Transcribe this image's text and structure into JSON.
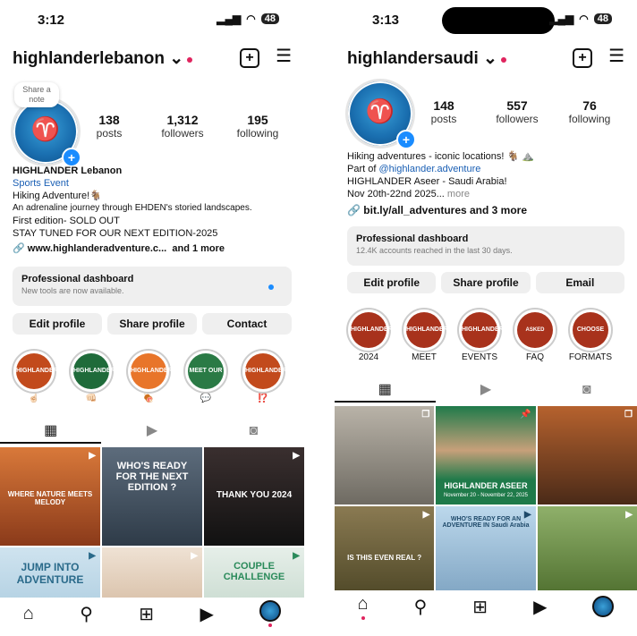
{
  "left": {
    "time": "3:12",
    "battery": "48",
    "username": "highlanderlebanon",
    "note_label": "Share a note",
    "stats": [
      {
        "value": "138",
        "label": "posts"
      },
      {
        "value": "1,312",
        "label": "followers"
      },
      {
        "value": "195",
        "label": "following"
      }
    ],
    "display_name": "HIGHLANDER Lebanon",
    "category": "Sports Event",
    "bio_lines": [
      "Hiking Adventure!🐐",
      "An adrenaline journey through EHDEN's storied landscapes.",
      "First edition- SOLD OUT",
      "STAY TUNED FOR OUR NEXT EDITION-2025"
    ],
    "link": "www.highlanderadventure.c...",
    "link_more": "and 1 more",
    "dashboard_title": "Professional dashboard",
    "dashboard_sub": "New tools are now available.",
    "buttons": [
      "Edit profile",
      "Share profile",
      "Contact"
    ],
    "highlights": [
      {
        "label": "☝🏻",
        "inner": "HIGHLANDER",
        "color": "#c24a1c"
      },
      {
        "label": "👊🏻",
        "inner": "HIGHLANDER",
        "color": "#1f6b3a"
      },
      {
        "label": "🍖",
        "inner": "HIGHLANDER",
        "color": "#e8752a"
      },
      {
        "label": "💬",
        "inner": "MEET OUR",
        "color": "#2a7a45"
      },
      {
        "label": "⁉️",
        "inner": "HIGHLANDER",
        "color": "#c24a1c"
      }
    ],
    "posts": [
      {
        "caption": "WHERE NATURE MEETS MELODY",
        "bg": "#d9793a"
      },
      {
        "caption": "WHO'S READY FOR THE NEXT EDITION ?",
        "bg": "#4b5a6a"
      },
      {
        "caption": "THANK YOU 2024",
        "bg": "#2a2424"
      },
      {
        "caption": "JUMP INTO ADVENTURE",
        "bg": "#cfe3ef"
      },
      {
        "caption": "",
        "bg": "#e6d5c4"
      },
      {
        "caption": "COUPLE CHALLENGE",
        "bg": "#dfe9e4"
      }
    ]
  },
  "right": {
    "time": "3:13",
    "battery": "48",
    "username": "highlandersaudi",
    "stats": [
      {
        "value": "148",
        "label": "posts"
      },
      {
        "value": "557",
        "label": "followers"
      },
      {
        "value": "76",
        "label": "following"
      }
    ],
    "bio_line1": "Hiking adventures - iconic locations! 🐐 ⛰️",
    "bio_partof": "Part of",
    "bio_mention": "@highlander.adventure",
    "bio_line3": "HIGHLANDER Aseer - Saudi Arabia!",
    "bio_line4": "Nov 20th-22nd 2025...",
    "bio_more": "more",
    "link": "bit.ly/all_adventures and 3 more",
    "dashboard_title": "Professional dashboard",
    "dashboard_sub": "12.4K accounts reached in the last 30 days.",
    "buttons": [
      "Edit profile",
      "Share profile",
      "Email"
    ],
    "highlights": [
      {
        "label": "2024",
        "inner": "HIGHLANDER",
        "color": "#a8321c"
      },
      {
        "label": "MEET",
        "inner": "HIGHLANDER",
        "color": "#a8321c"
      },
      {
        "label": "EVENTS",
        "inner": "HIGHLANDER",
        "color": "#a8321c"
      },
      {
        "label": "FAQ",
        "inner": "ASKED QUESTIONS",
        "color": "#a8321c"
      },
      {
        "label": "FORMATS",
        "inner": "CHOOSE YOUR",
        "color": "#a8321c"
      }
    ],
    "posts": [
      {
        "caption": "",
        "bg": "#8a8f93"
      },
      {
        "caption": "HIGHLANDER ASEER",
        "sub": "November 20 - November 22, 2025",
        "bg": "#1f7a4a"
      },
      {
        "caption": "",
        "bg": "#a0562a"
      },
      {
        "caption": "IS THIS EVEN REAL ?",
        "bg": "#6d6a3e"
      },
      {
        "caption": "WHO'S READY FOR AN ADVENTURE IN Saudi Arabia",
        "bg": "#9dc1dc"
      },
      {
        "caption": "",
        "bg": "#5e7a3a"
      }
    ]
  }
}
